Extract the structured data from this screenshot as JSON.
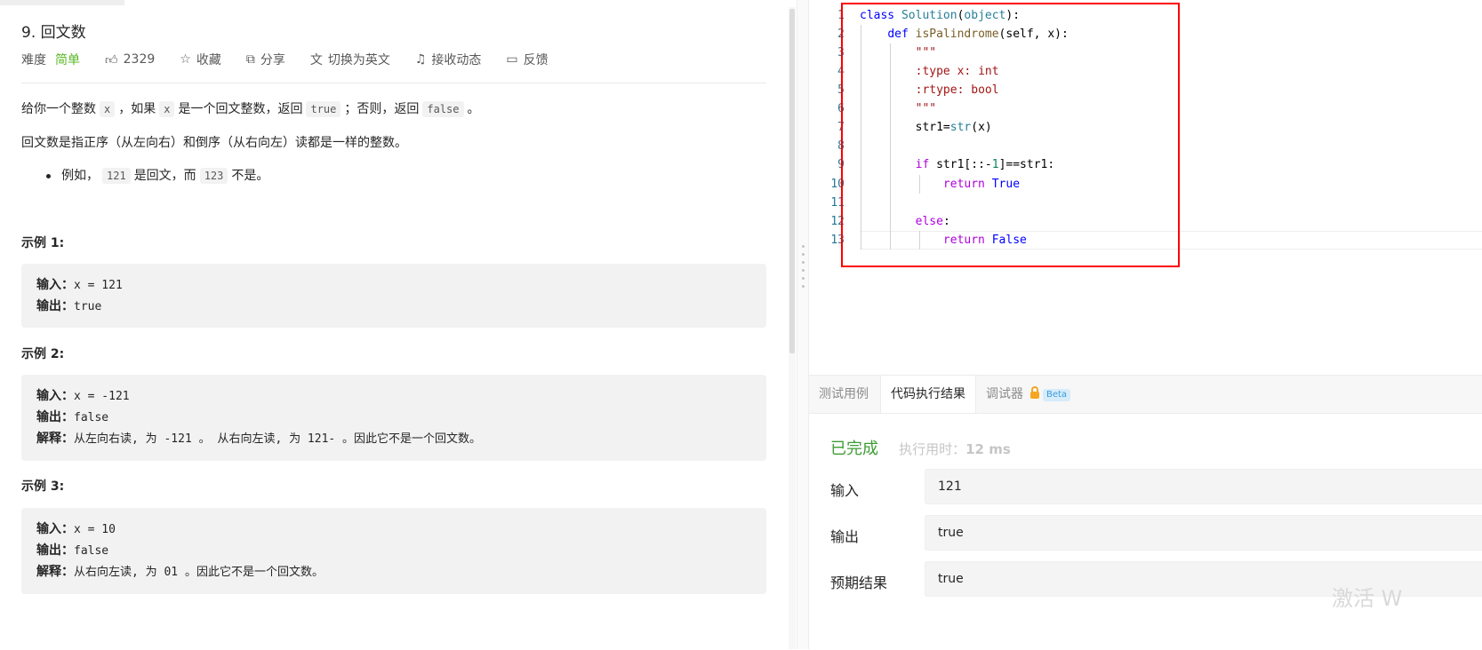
{
  "problem": {
    "title": "9. 回文数",
    "difficulty_label": "难度",
    "difficulty_value": "简单",
    "likes": "2329",
    "favorite_label": "收藏",
    "share_label": "分享",
    "switch_lang_label": "切换为英文",
    "notify_label": "接收动态",
    "feedback_label": "反馈",
    "desc1": {
      "a": "给你一个整数",
      "x1": "x",
      "b": "，如果",
      "x2": "x",
      "c": "是一个回文整数，返回",
      "t": "true",
      "d": "；否则，返回",
      "f": "false",
      "e": "。"
    },
    "desc2": "回文数是指正序（从左向右）和倒序（从右向左）读都是一样的整数。",
    "bullet": {
      "a": "例如，",
      "n1": "121",
      "b": "是回文，而",
      "n2": "123",
      "c": "不是。"
    },
    "examples": [
      {
        "title": "示例 1:",
        "input_label": "输入：",
        "input": "x = 121",
        "output_label": "输出：",
        "output": "true"
      },
      {
        "title": "示例 2:",
        "input_label": "输入：",
        "input": "x = -121",
        "output_label": "输出：",
        "output": "false",
        "explain_label": "解释：",
        "explain": "从左向右读, 为 -121 。 从右向左读, 为 121- 。因此它不是一个回文数。"
      },
      {
        "title": "示例 3:",
        "input_label": "输入：",
        "input": "x = 10",
        "output_label": "输出：",
        "output": "false",
        "explain_label": "解释：",
        "explain": "从右向左读, 为 01 。因此它不是一个回文数。"
      }
    ]
  },
  "editor": {
    "line_numbers": [
      "1",
      "2",
      "3",
      "4",
      "5",
      "6",
      "7",
      "8",
      "9",
      "10",
      "11",
      "12",
      "13"
    ],
    "code": {
      "l1": {
        "kw": "class",
        "cls": "Solution",
        "p1": "(",
        "blt": "object",
        "p2": "):"
      },
      "l2": {
        "kw": "def",
        "fn": "isPalindrome",
        "rest": "(self, x):"
      },
      "l3": "\"\"\"",
      "l4": ":type x: int",
      "l5": ":rtype: bool",
      "l6": "\"\"\"",
      "l7": {
        "a": "str1=",
        "fn": "str",
        "b": "(x)"
      },
      "l9": {
        "kw": "if",
        "a": " str1[::-",
        "num": "1",
        "b": "]==str1:"
      },
      "l10": {
        "kw": "return",
        "val": "True"
      },
      "l12": {
        "kw": "else",
        "b": ":"
      },
      "l13": {
        "kw": "return",
        "val": "False"
      }
    }
  },
  "console": {
    "tabs": [
      {
        "label": "测试用例"
      },
      {
        "label": "代码执行结果"
      },
      {
        "label": "调试器"
      }
    ],
    "beta_label": "Beta",
    "status": "已完成",
    "exec_time_label": "执行用时：",
    "exec_time_value": "12 ms",
    "input_label": "输入",
    "input_value": "121",
    "output_label": "输出",
    "output_value": "true",
    "expected_label": "预期结果",
    "expected_value": "true"
  },
  "watermark": "激活 W",
  "colors": {
    "easy": "#5ab726",
    "success": "#3f9c35",
    "highlight_border": "#ff0000"
  }
}
